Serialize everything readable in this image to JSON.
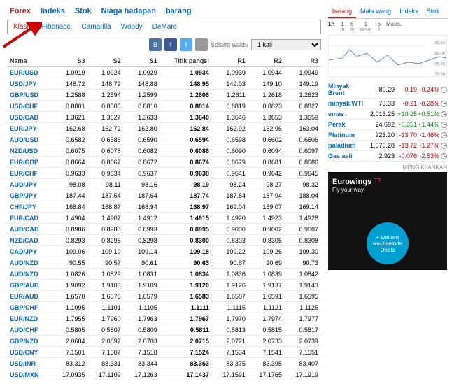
{
  "tabs1": [
    "Forex",
    "Indeks",
    "Stok",
    "Niaga hadapan",
    "barang"
  ],
  "tabs1_active": 0,
  "tabs2": [
    "Klasik",
    "Fibonacci",
    "Camarilla",
    "Woody",
    "DeMarc"
  ],
  "tabs2_active": 0,
  "controls": {
    "interval_label": "Selang waktu",
    "interval_value": "1 kali"
  },
  "headers": [
    "Nama",
    "S3",
    "S2",
    "S1",
    "Titik pangsi",
    "R1",
    "R2",
    "R3"
  ],
  "rows": [
    {
      "n": "EUR/USD",
      "s3": "1.0919",
      "s2": "1.0924",
      "s1": "1.0929",
      "p": "1.0934",
      "r1": "1.0939",
      "r2": "1.0944",
      "r3": "1.0949"
    },
    {
      "n": "USD/JPY",
      "s3": "148.72",
      "s2": "148.79",
      "s1": "148.88",
      "p": "148.95",
      "r1": "149.03",
      "r2": "149.10",
      "r3": "149.19"
    },
    {
      "n": "GBP/USD",
      "s3": "1.2588",
      "s2": "1.2594",
      "s1": "1.2599",
      "p": "1.2606",
      "r1": "1.2611",
      "r2": "1.2618",
      "r3": "1.2623"
    },
    {
      "n": "USD/CHF",
      "s3": "0.8801",
      "s2": "0.8805",
      "s1": "0.8810",
      "p": "0.8814",
      "r1": "0.8819",
      "r2": "0.8823",
      "r3": "0.8827"
    },
    {
      "n": "USD/CAD",
      "s3": "1.3621",
      "s2": "1.3627",
      "s1": "1.3633",
      "p": "1.3640",
      "r1": "1.3646",
      "r2": "1.3653",
      "r3": "1.3659"
    },
    {
      "n": "EUR/JPY",
      "s3": "162.68",
      "s2": "162.72",
      "s1": "162.80",
      "p": "162.84",
      "r1": "162.92",
      "r2": "162.96",
      "r3": "163.04"
    },
    {
      "n": "AUD/USD",
      "s3": "0.6582",
      "s2": "0.6586",
      "s1": "0.6590",
      "p": "0.6594",
      "r1": "0.6598",
      "r2": "0.6602",
      "r3": "0.6606"
    },
    {
      "n": "NZD/USD",
      "s3": "0.6075",
      "s2": "0.6078",
      "s1": "0.6082",
      "p": "0.6086",
      "r1": "0.6090",
      "r2": "0.6094",
      "r3": "0.6097"
    },
    {
      "n": "EUR/GBP",
      "s3": "0.8664",
      "s2": "0.8667",
      "s1": "0.8672",
      "p": "0.8674",
      "r1": "0.8679",
      "r2": "0.8681",
      "r3": "0.8686"
    },
    {
      "n": "EUR/CHF",
      "s3": "0.9633",
      "s2": "0.9634",
      "s1": "0.9637",
      "p": "0.9638",
      "r1": "0.9641",
      "r2": "0.9642",
      "r3": "0.9645"
    },
    {
      "n": "AUD/JPY",
      "s3": "98.08",
      "s2": "98.11",
      "s1": "98.16",
      "p": "98.19",
      "r1": "98.24",
      "r2": "98.27",
      "r3": "98.32"
    },
    {
      "n": "GBP/JPY",
      "s3": "187.44",
      "s2": "187.54",
      "s1": "187.64",
      "p": "187.74",
      "r1": "187.84",
      "r2": "187.94",
      "r3": "188.04"
    },
    {
      "n": "CHF/JPY",
      "s3": "168.84",
      "s2": "168.87",
      "s1": "168.94",
      "p": "168.97",
      "r1": "169.04",
      "r2": "169.07",
      "r3": "169.14"
    },
    {
      "n": "EUR/CAD",
      "s3": "1.4904",
      "s2": "1.4907",
      "s1": "1.4912",
      "p": "1.4915",
      "r1": "1.4920",
      "r2": "1.4923",
      "r3": "1.4928"
    },
    {
      "n": "AUD/CAD",
      "s3": "0.8986",
      "s2": "0.8988",
      "s1": "0.8993",
      "p": "0.8995",
      "r1": "0.9000",
      "r2": "0.9002",
      "r3": "0.9007"
    },
    {
      "n": "NZD/CAD",
      "s3": "0.8293",
      "s2": "0.8295",
      "s1": "0.8298",
      "p": "0.8300",
      "r1": "0.8303",
      "r2": "0.8305",
      "r3": "0.8308"
    },
    {
      "n": "CAD/JPY",
      "s3": "109.06",
      "s2": "109.10",
      "s1": "109.14",
      "p": "109.18",
      "r1": "109.22",
      "r2": "109.26",
      "r3": "109.30"
    },
    {
      "n": "AUD/NZD",
      "s3": "90.55",
      "s2": "90.57",
      "s1": "90.61",
      "p": "90.63",
      "r1": "90.67",
      "r2": "90.69",
      "r3": "90.73"
    },
    {
      "n": "AUD/NZD",
      "s3": "1.0826",
      "s2": "1.0829",
      "s1": "1.0831",
      "p": "1.0834",
      "r1": "1.0836",
      "r2": "1.0839",
      "r3": "1.0842"
    },
    {
      "n": "GBP/AUD",
      "s3": "1.9092",
      "s2": "1.9103",
      "s1": "1.9109",
      "p": "1.9120",
      "r1": "1.9126",
      "r2": "1.9137",
      "r3": "1.9143"
    },
    {
      "n": "EUR/AUD",
      "s3": "1.6570",
      "s2": "1.6575",
      "s1": "1.6579",
      "p": "1.6583",
      "r1": "1.6587",
      "r2": "1.6591",
      "r3": "1.6595"
    },
    {
      "n": "GBP/CHF",
      "s3": "1.1095",
      "s2": "1.1101",
      "s1": "1.1105",
      "p": "1.1111",
      "r1": "1.1115",
      "r2": "1.1121",
      "r3": "1.1125"
    },
    {
      "n": "EUR/NZD",
      "s3": "1.7955",
      "s2": "1.7960",
      "s1": "1.7963",
      "p": "1.7967",
      "r1": "1.7970",
      "r2": "1.7974",
      "r3": "1.7977"
    },
    {
      "n": "AUD/CHF",
      "s3": "0.5805",
      "s2": "0.5807",
      "s1": "0.5809",
      "p": "0.5811",
      "r1": "0.5813",
      "r2": "0.5815",
      "r3": "0.5817"
    },
    {
      "n": "GBP/NZD",
      "s3": "2.0684",
      "s2": "2.0697",
      "s1": "2.0703",
      "p": "2.0715",
      "r1": "2.0721",
      "r2": "2.0733",
      "r3": "2.0739"
    },
    {
      "n": "USD/CNY",
      "s3": "7.1501",
      "s2": "7.1507",
      "s1": "7.1518",
      "p": "7.1524",
      "r1": "7.1534",
      "r2": "7.1541",
      "r3": "7.1551"
    },
    {
      "n": "USD/INR",
      "s3": "83.312",
      "s2": "83.331",
      "s1": "83.344",
      "p": "83.363",
      "r1": "83.375",
      "r2": "83.395",
      "r3": "83.407"
    },
    {
      "n": "USD/MXN",
      "s3": "17.0935",
      "s2": "17.1109",
      "s1": "17.1263",
      "p": "17.1437",
      "r1": "17.1591",
      "r2": "17.1765",
      "r3": "17.1919"
    }
  ],
  "side_tabs": [
    "barang",
    "Mata wang",
    "Indeks",
    "Stok"
  ],
  "side_tabs_active": 0,
  "tf": [
    {
      "a": "1h",
      "b": ""
    },
    {
      "a": "1",
      "b": "m"
    },
    {
      "a": "6",
      "b": "m"
    },
    {
      "a": "1",
      "b": "tahun"
    },
    {
      "a": "5",
      "b": "t"
    },
    {
      "a": "Maks.",
      "b": ""
    }
  ],
  "tf_active": 0,
  "chart_axis": [
    "80,50",
    "80,00",
    "79,50",
    "79,00"
  ],
  "instruments": [
    {
      "nm": "Minyak Brent",
      "val": "80.29",
      "chg": "-0.19",
      "pct": "-0.24%",
      "dir": "neg"
    },
    {
      "nm": "minyak WTI",
      "val": "75.33",
      "chg": "-0.21",
      "pct": "-0.28%",
      "dir": "neg"
    },
    {
      "nm": "emas",
      "val": "2.013.25",
      "chg": "+10.25",
      "pct": "+0.51%",
      "dir": "pos"
    },
    {
      "nm": "Perak",
      "val": "24.692",
      "chg": "+0.351",
      "pct": "+1.44%",
      "dir": "pos"
    },
    {
      "nm": "Platinum",
      "val": "923.20",
      "chg": "-13.70",
      "pct": "-1.46%",
      "dir": "neg"
    },
    {
      "nm": "paladium",
      "val": "1,070.28",
      "chg": "-13.72",
      "pct": "-1.27%",
      "dir": "neg"
    },
    {
      "nm": "Gas asli",
      "val": "2.923",
      "chg": "-0.076",
      "pct": "-2.53%",
      "dir": "neg"
    }
  ],
  "ad": {
    "label": "MENGIKLANKAN",
    "logo": "Eurowings",
    "sub": "Fly your way",
    "bubble": "+ weitere wechselnde Deals"
  }
}
